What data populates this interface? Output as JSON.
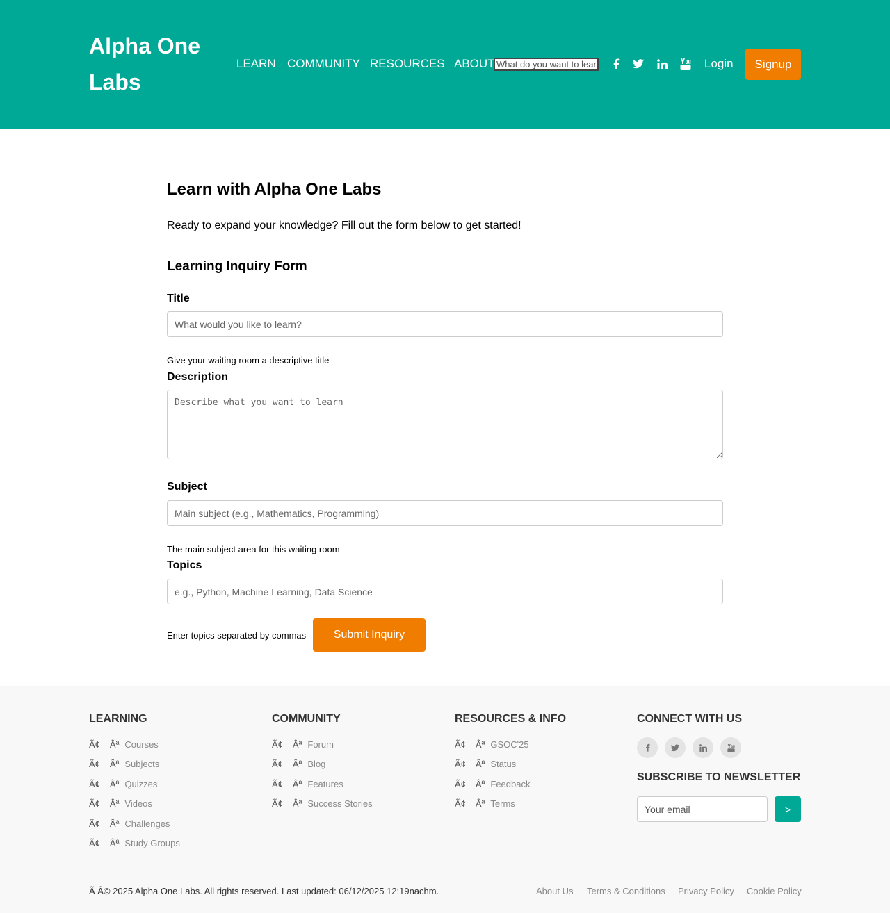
{
  "header": {
    "brand": "Alpha One Labs",
    "nav": [
      "LEARN",
      "COMMUNITY",
      "RESOURCES",
      "ABOUT"
    ],
    "search_placeholder": "What do you want to learn?",
    "social_icons": [
      "facebook-icon",
      "twitter-icon",
      "linkedin-icon",
      "youtube-icon"
    ],
    "login": "Login",
    "signup": "Signup"
  },
  "main": {
    "title": "Learn with Alpha One Labs",
    "intro": "Ready to expand your knowledge? Fill out the form below to get started!",
    "form_title": "Learning Inquiry Form",
    "fields": {
      "title_label": "Title",
      "title_placeholder": "What would you like to learn?",
      "title_help": "Give your waiting room a descriptive title",
      "description_label": "Description",
      "description_placeholder": "Describe what you want to learn",
      "subject_label": "Subject",
      "subject_placeholder": "Main subject (e.g., Mathematics, Programming)",
      "subject_help": "The main subject area for this waiting room",
      "topics_label": "Topics",
      "topics_placeholder": "e.g., Python, Machine Learning, Data Science",
      "topics_help": "Enter topics separated by commas"
    },
    "submit": "Submit Inquiry"
  },
  "footer": {
    "bullet_a": "Ã¢",
    "bullet_b": "Âª",
    "learning": {
      "heading": "LEARNING",
      "links": [
        "Courses",
        "Subjects",
        "Quizzes",
        "Videos",
        "Challenges",
        "Study Groups"
      ]
    },
    "community": {
      "heading": "COMMUNITY",
      "links": [
        "Forum",
        "Blog",
        "Features",
        "Success Stories"
      ]
    },
    "resources": {
      "heading": "RESOURCES & INFO",
      "links": [
        "GSOC'25",
        "Status",
        "Feedback",
        "Terms"
      ]
    },
    "connect": {
      "heading": "CONNECT WITH US",
      "social_icons": [
        "facebook-icon",
        "twitter-icon",
        "linkedin-icon",
        "youtube-icon"
      ]
    },
    "newsletter": {
      "heading": "SUBSCRIBE TO NEWSLETTER",
      "email_placeholder": "Your email",
      "submit": ">"
    },
    "copyright": "Ã   Â© 2025 Alpha One Labs. All rights reserved. Last updated: 06/12/2025 12:19nachm.",
    "legal": [
      "About Us",
      "Terms & Conditions",
      "Privacy Policy",
      "Cookie Policy"
    ]
  },
  "colors": {
    "brand_teal": "#00a896",
    "accent_orange": "#f07c00",
    "footer_bg": "#f8f8f8"
  }
}
